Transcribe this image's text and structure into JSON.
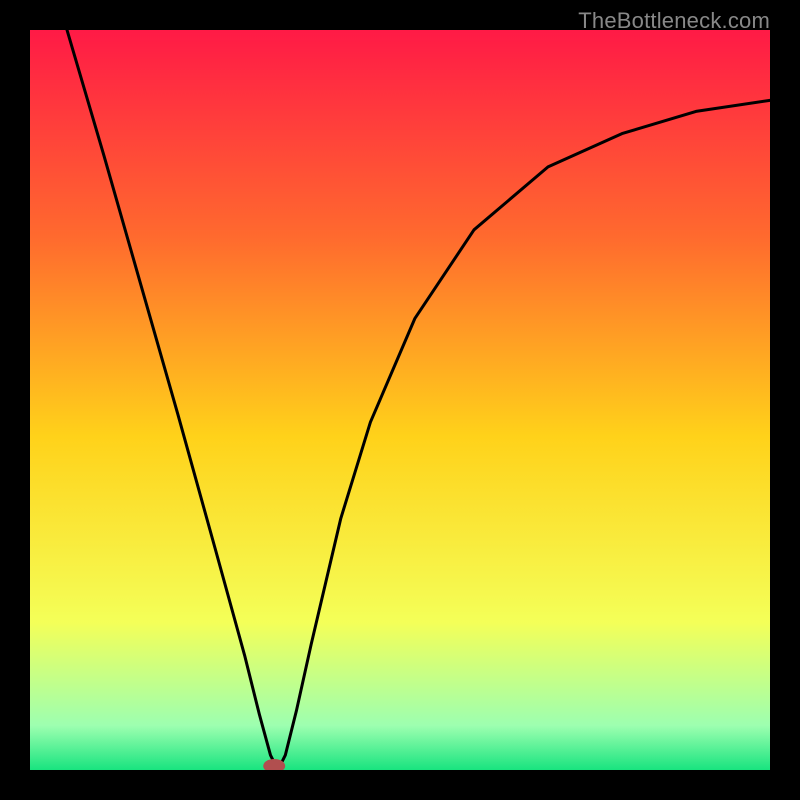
{
  "watermark": "TheBottleneck.com",
  "chart_data": {
    "type": "line",
    "title": "",
    "xlabel": "",
    "ylabel": "",
    "xlim": [
      0,
      1
    ],
    "ylim": [
      0,
      1
    ],
    "annotations": [],
    "background_gradient": {
      "top": "#ff1a46",
      "upper_mid": "#ff6a2e",
      "mid": "#ffd21a",
      "lower_mid": "#f4ff58",
      "near_bottom": "#9dffb0",
      "bottom": "#18e47f"
    },
    "optimum_marker": {
      "x": 0.33,
      "y": 0.0,
      "color": "#b14f4f"
    },
    "series": [
      {
        "name": "bottleneck-curve",
        "color": "#000000",
        "x": [
          0.05,
          0.1,
          0.15,
          0.2,
          0.25,
          0.29,
          0.31,
          0.325,
          0.335,
          0.345,
          0.36,
          0.38,
          0.42,
          0.46,
          0.52,
          0.6,
          0.7,
          0.8,
          0.9,
          1.0
        ],
        "y": [
          1.0,
          0.83,
          0.655,
          0.48,
          0.3,
          0.155,
          0.075,
          0.02,
          0.0,
          0.02,
          0.08,
          0.17,
          0.34,
          0.47,
          0.61,
          0.73,
          0.815,
          0.86,
          0.89,
          0.905
        ]
      }
    ]
  }
}
